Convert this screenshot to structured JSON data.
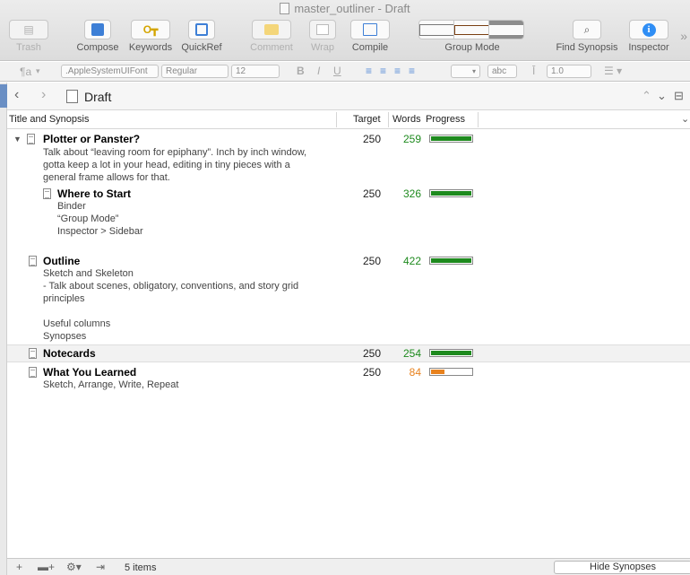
{
  "window": {
    "title": "master_outliner - Draft"
  },
  "toolbar": {
    "trash": "Trash",
    "compose": "Compose",
    "keywords": "Keywords",
    "quickref": "QuickRef",
    "comment": "Comment",
    "wrap": "Wrap",
    "compile": "Compile",
    "group_mode": "Group Mode",
    "find_synopsis": "Find Synopsis",
    "inspector": "Inspector",
    "overflow": "»"
  },
  "format_bar": {
    "style": "¶a",
    "font": ".AppleSystemUIFont",
    "weight": "Regular",
    "size": "12",
    "bold": "B",
    "italic": "I",
    "underline": "U",
    "highlight": "abc",
    "spacing": "1.0"
  },
  "editor": {
    "crumb": "Draft",
    "columns": {
      "title": "Title and Synopsis",
      "target": "Target",
      "words": "Words",
      "progress": "Progress"
    },
    "rows": [
      {
        "title": "Plotter or Panster?",
        "synopsis": "Talk about “leaving room for epiphany”. Inch by inch window,\ngotta keep a lot in your head, editing in tiny pieces with a\ngeneral frame allows for that.",
        "target": "250",
        "words": "259",
        "progress": 1.0,
        "status_color": "#1e8a1e"
      },
      {
        "title": "Where to Start",
        "synopsis": "Binder\n“Group Mode”\nInspector > Sidebar",
        "target": "250",
        "words": "326",
        "progress": 1.0,
        "status_color": "#1e8a1e"
      },
      {
        "title": "Outline",
        "synopsis": "Sketch and Skeleton\n- Talk about scenes, obligatory, conventions, and story grid\nprinciples\n\nUseful columns\nSynopses",
        "target": "250",
        "words": "422",
        "progress": 1.0,
        "status_color": "#1e8a1e"
      },
      {
        "title": "Notecards",
        "synopsis": "",
        "target": "250",
        "words": "254",
        "progress": 1.0,
        "status_color": "#1e8a1e"
      },
      {
        "title": "What You Learned",
        "synopsis": "Sketch, Arrange, Write, Repeat",
        "target": "250",
        "words": "84",
        "progress": 0.34,
        "status_color": "#e8821e"
      }
    ]
  },
  "bottom_bar": {
    "count": "5 items",
    "hide_synopses": "Hide Synopses"
  }
}
